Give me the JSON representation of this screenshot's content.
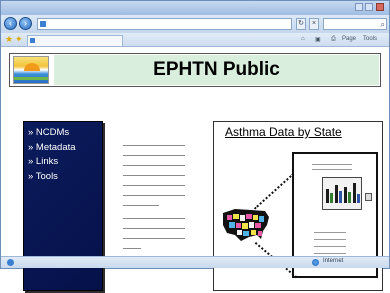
{
  "browser": {
    "back_icon": "back-arrow-icon",
    "forward_icon": "forward-arrow-icon",
    "tab_row_tools": [
      "Page",
      "Tools"
    ],
    "status_zone": "Internet"
  },
  "page": {
    "title": "EPHTN Public",
    "nav": {
      "items": [
        {
          "label": "» NCDMs"
        },
        {
          "label": "» Metadata"
        },
        {
          "label": "» Links"
        },
        {
          "label": "» Tools"
        }
      ]
    },
    "panel": {
      "title": "Asthma Data by State"
    }
  },
  "colors": {
    "nav_background": "#0b1b5c",
    "title_background": "#d9eedc",
    "browser_chrome": "#c5d7ee"
  }
}
